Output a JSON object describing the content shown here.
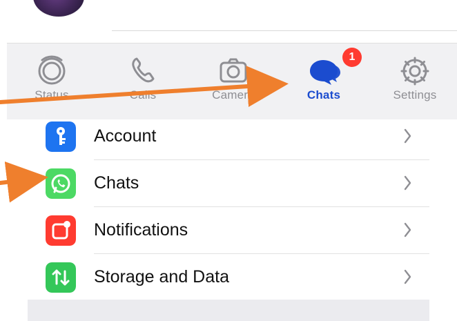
{
  "tabs": [
    {
      "label": "Status",
      "icon": "status-icon",
      "active": false
    },
    {
      "label": "Calls",
      "icon": "phone-icon",
      "active": false
    },
    {
      "label": "Camera",
      "icon": "camera-icon",
      "active": false
    },
    {
      "label": "Chats",
      "icon": "chats-bubble-icon",
      "active": true,
      "badge": "1"
    },
    {
      "label": "Settings",
      "icon": "gear-icon",
      "active": false
    }
  ],
  "settings": {
    "items": [
      {
        "label": "Account",
        "icon": "key-icon",
        "color": "#1e74f0"
      },
      {
        "label": "Chats",
        "icon": "whatsapp-icon",
        "color": "#4cd964"
      },
      {
        "label": "Notifications",
        "icon": "notification-icon",
        "color": "#ff3b30"
      },
      {
        "label": "Storage and Data",
        "icon": "storage-data-icon",
        "color": "#34c759"
      }
    ]
  },
  "colors": {
    "active_tab": "#1b4ccf",
    "inactive_tab": "#8e8e93",
    "annotation_arrow": "#ef7f2d",
    "badge": "#ff3b30"
  }
}
